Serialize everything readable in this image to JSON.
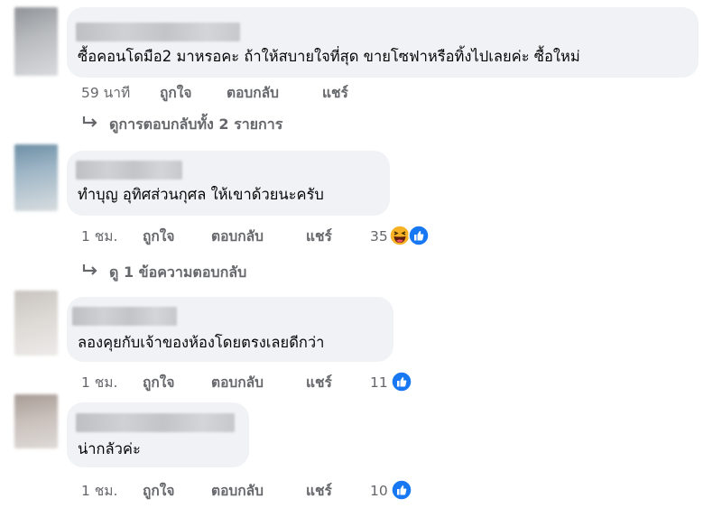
{
  "colors": {
    "bubble": "#f0f2f5",
    "meta_text": "#65676b",
    "like_blue": "#1877f2",
    "haha_yellow": "#f7b125"
  },
  "comments": [
    {
      "text": "ซื้อคอนโดมือ2 มาหรอคะ ถ้าให้สบายใจที่สุด ขายโซฟาหรือทิ้งไปเลยค่ะ ซื้อใหม่",
      "time": "59 นาที",
      "like": "ถูกใจ",
      "reply": "ตอบกลับ",
      "share": "แชร์",
      "view_replies": "ดูการตอบกลับทั้ง 2 รายการ"
    },
    {
      "text": "ทำบุญ อุทิศส่วนกุศล ให้เขาด้วยนะครับ",
      "time": "1 ชม.",
      "like": "ถูกใจ",
      "reply": "ตอบกลับ",
      "share": "แชร์",
      "reactions": "35",
      "reaction_icons": [
        "haha-icon",
        "like-icon"
      ],
      "view_replies": "ดู 1 ข้อความตอบกลับ"
    },
    {
      "text": "ลองคุยกับเจ้าของห้องโดยตรงเลยดีกว่า",
      "time": "1 ชม.",
      "like": "ถูกใจ",
      "reply": "ตอบกลับ",
      "share": "แชร์",
      "reactions": "11",
      "reaction_icons": [
        "like-icon"
      ]
    },
    {
      "text": "น่ากลัวค่ะ",
      "time": "1 ชม.",
      "like": "ถูกใจ",
      "reply": "ตอบกลับ",
      "share": "แชร์",
      "reactions": "10",
      "reaction_icons": [
        "like-icon"
      ]
    }
  ]
}
